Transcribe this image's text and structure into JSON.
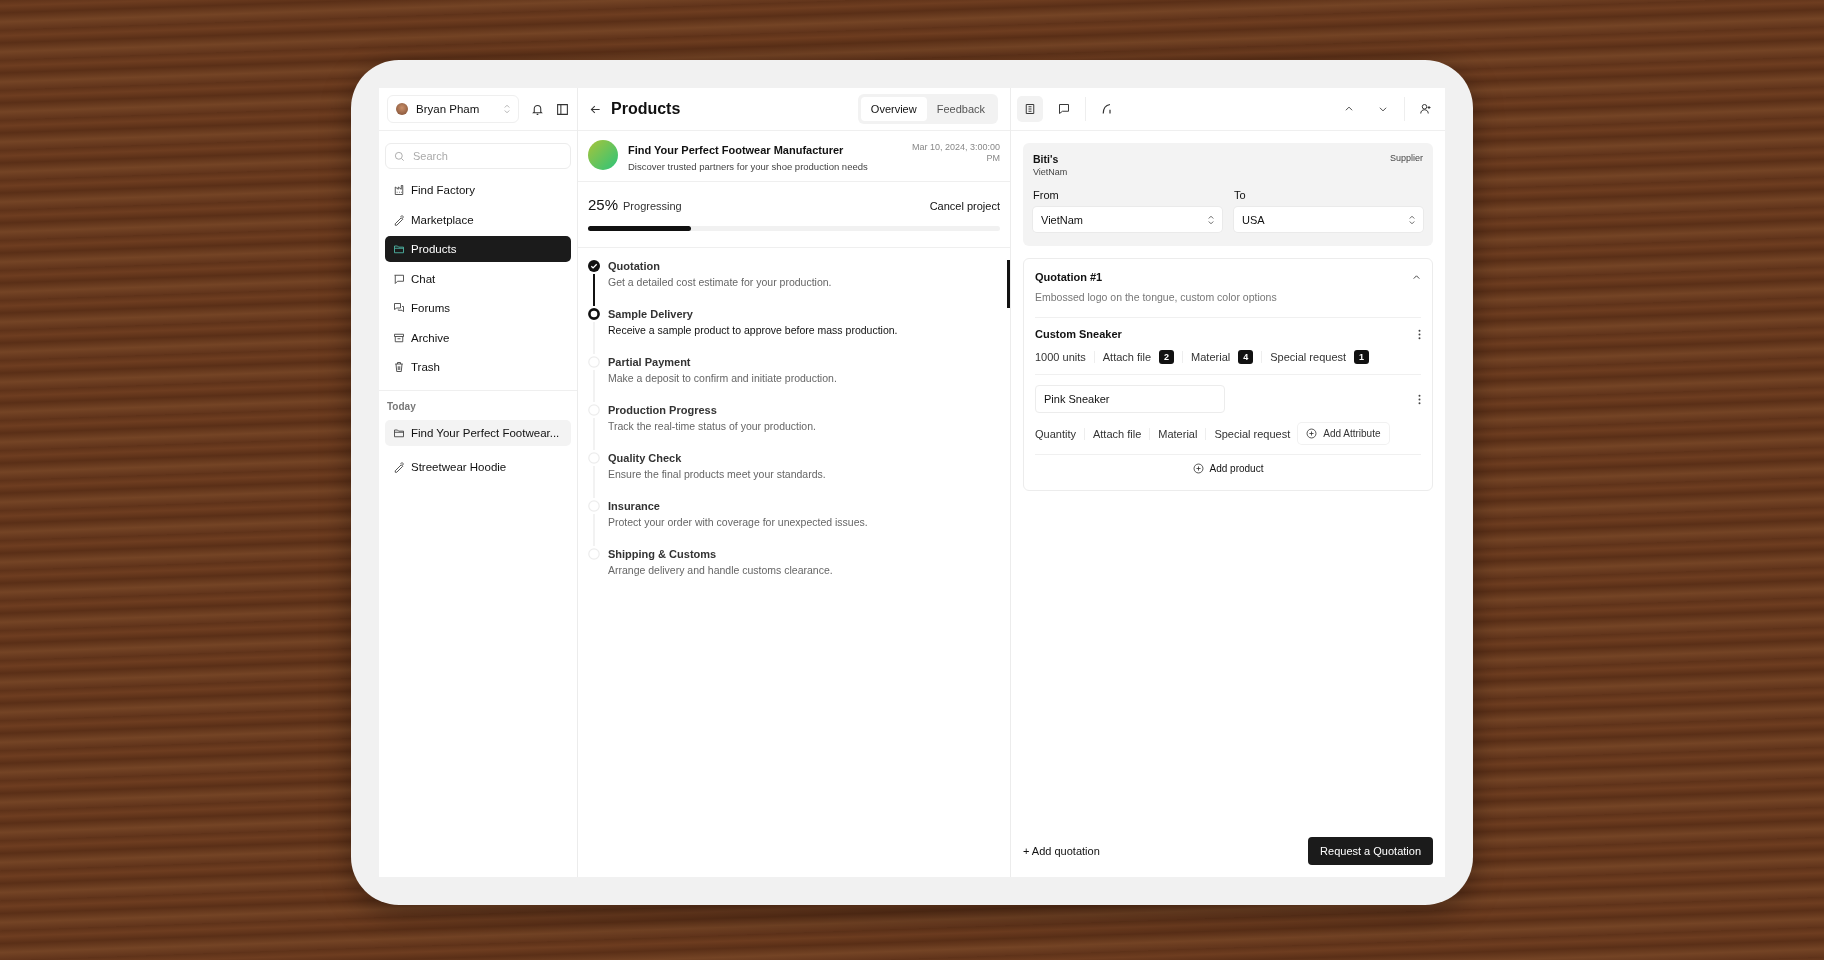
{
  "sidebar": {
    "user": {
      "name": "Bryan Pham"
    },
    "search": {
      "placeholder": "Search"
    },
    "items": [
      {
        "label": "Find Factory",
        "selected": false
      },
      {
        "label": "Marketplace",
        "selected": false
      },
      {
        "label": "Products",
        "selected": true
      },
      {
        "label": "Chat",
        "selected": false
      },
      {
        "label": "Forums",
        "selected": false
      },
      {
        "label": "Archive",
        "selected": false
      },
      {
        "label": "Trash",
        "selected": false
      }
    ],
    "section": "Today",
    "recent": [
      {
        "label": "Find Your Perfect Footwear...",
        "selected": true
      },
      {
        "label": "Streetwear Hoodie",
        "selected": false
      }
    ]
  },
  "header": {
    "title": "Products",
    "tabs": [
      {
        "label": "Overview",
        "selected": true
      },
      {
        "label": "Feedback",
        "selected": false
      }
    ]
  },
  "project": {
    "title": "Find Your Perfect Footwear Manufacturer",
    "subtitle": "Discover trusted partners for your shoe production needs",
    "date": "Mar 10, 2024, 3:00:00 PM"
  },
  "progress": {
    "percent": "25%",
    "label": "Progressing",
    "level": 0.25,
    "action": "Cancel project"
  },
  "steps": [
    {
      "title": "Quotation",
      "description": "Get a detailed cost estimate for your production.",
      "kind": "done"
    },
    {
      "title": "Sample Delivery",
      "description": "Receive a sample product to approve before mass production.",
      "kind": "current"
    },
    {
      "title": "Partial Payment",
      "description": "Make a deposit to confirm and initiate production.",
      "kind": "pending"
    },
    {
      "title": "Production Progress",
      "description": "Track the real-time status of your production.",
      "kind": "pending"
    },
    {
      "title": "Quality Check",
      "description": "Ensure the final products meet your standards.",
      "kind": "pending"
    },
    {
      "title": "Insurance",
      "description": "Protect your order with coverage for unexpected issues.",
      "kind": "pending"
    },
    {
      "title": "Shipping & Customs",
      "description": "Arrange delivery and handle customs clearance.",
      "kind": "pending"
    }
  ],
  "supplier": {
    "name": "Biti's",
    "country": "VietNam",
    "role": "Supplier",
    "from_label": "From",
    "from": "VietNam",
    "to_label": "To",
    "to": "USA"
  },
  "quotation": {
    "title": "Quotation #1",
    "description": "Embossed logo on the tongue, custom color options",
    "expanded": true,
    "products": [
      {
        "name": "Custom Sneaker",
        "kind": "saved",
        "attributes": [
          {
            "label": "1000 units"
          },
          {
            "label": "Attach file",
            "count": "2"
          },
          {
            "label": "Material",
            "count": "4"
          },
          {
            "label": "Special request",
            "count": "1"
          }
        ]
      },
      {
        "name": "Pink Sneaker",
        "kind": "editing",
        "attributes": [
          {
            "label": "Quantity"
          },
          {
            "label": "Attach file"
          },
          {
            "label": "Material"
          },
          {
            "label": "Special request"
          }
        ],
        "add_attribute": "Add Attribute"
      }
    ],
    "add_product": "Add product"
  },
  "footer": {
    "add_quotation": "+ Add quotation",
    "request": "Request a Quotation"
  }
}
